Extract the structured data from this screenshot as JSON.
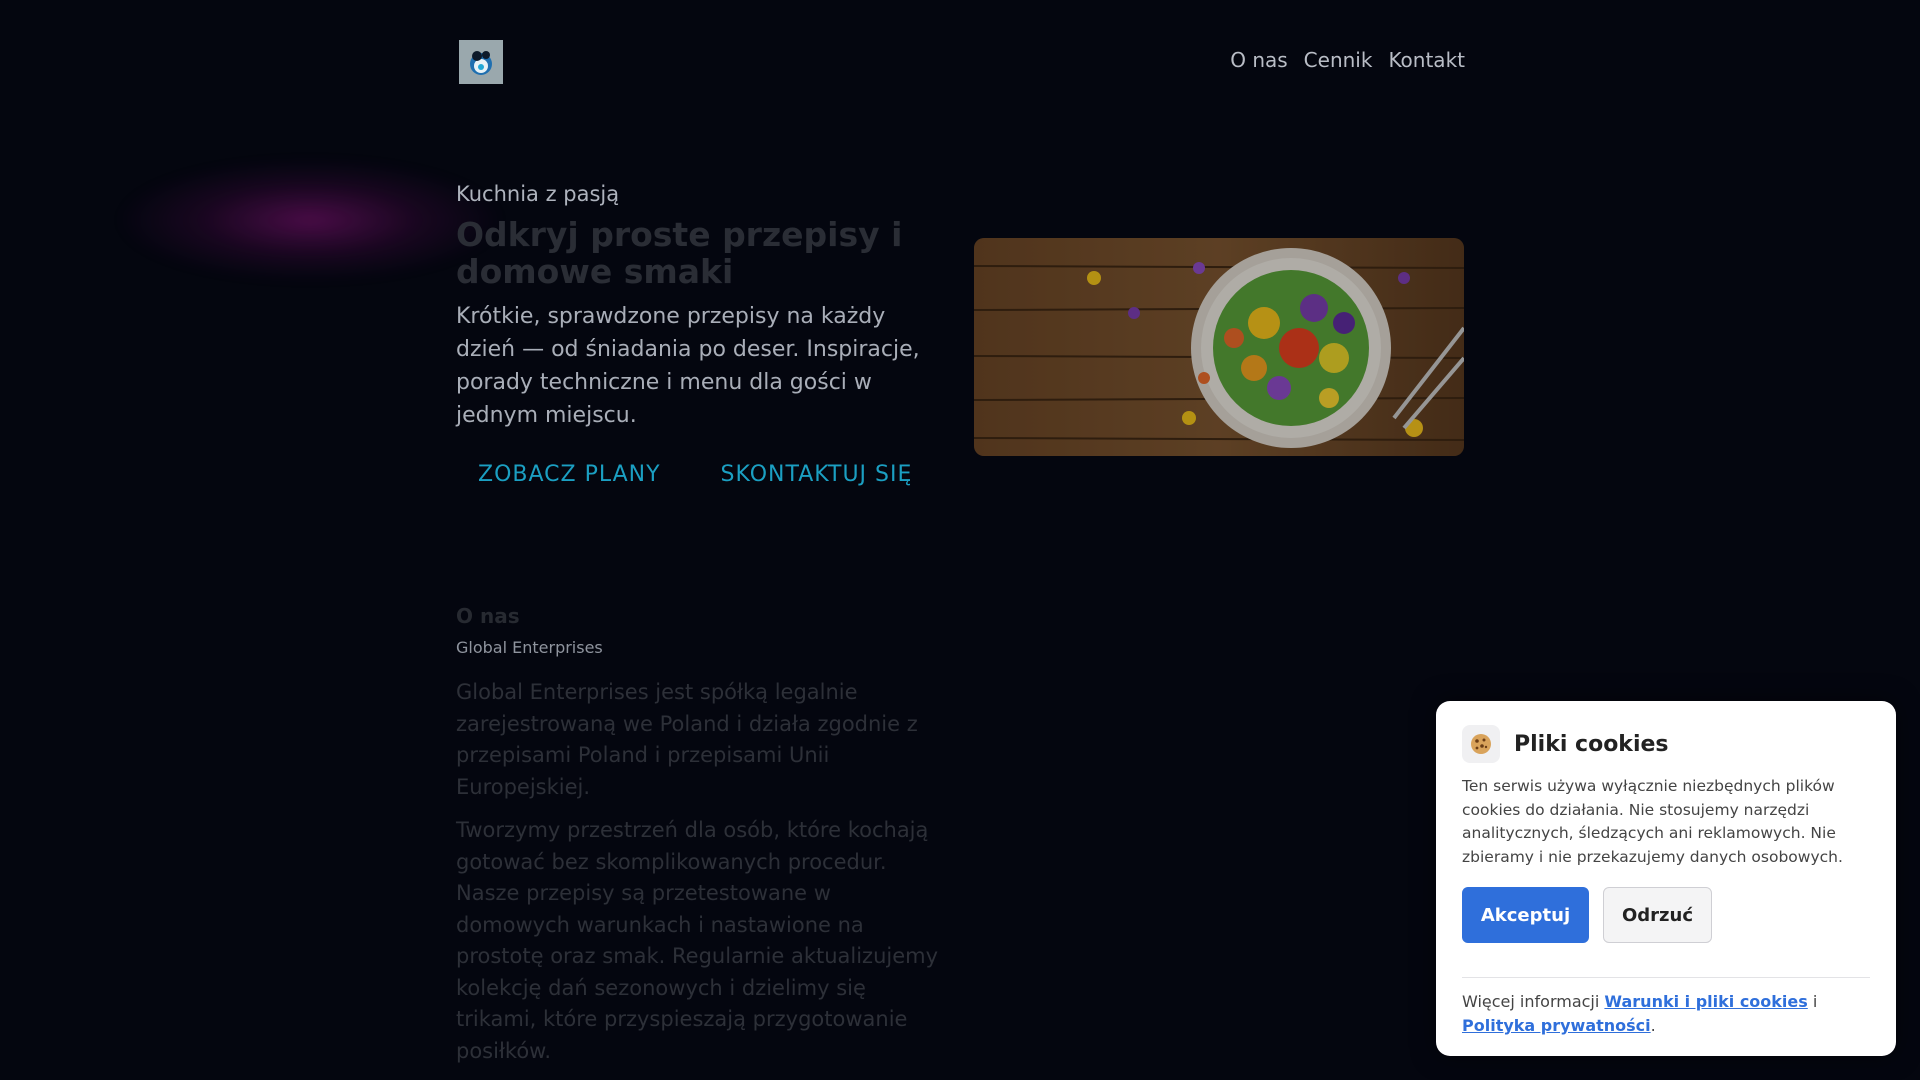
{
  "header": {
    "logo": "logo-icon",
    "nav": [
      {
        "label": "O nas"
      },
      {
        "label": "Cennik"
      },
      {
        "label": "Kontakt"
      }
    ]
  },
  "hero": {
    "eyebrow": "Kuchnia z pasją",
    "title": "Odkryj proste przepisy i domowe smaki",
    "text": "Krótkie, sprawdzone przepisy na każdy dzień — od śniadania po deser. Inspiracje, porady techniczne i menu dla gości w jednym miejscu.",
    "buttons": [
      {
        "label": "ZOBACZ PLANY"
      },
      {
        "label": "SKONTAKTUJ SIĘ"
      }
    ],
    "image": "flower-salad-plate-image"
  },
  "about": {
    "title": "O nas",
    "subtitle": "Global Enterprises",
    "paragraphs": [
      "Global Enterprises jest spółką legalnie zarejestrowaną we Poland i działa zgodnie z przepisami Poland i przepisami Unii Europejskiej.",
      "Tworzymy przestrzeń dla osób, które kochają gotować bez skomplikowanych procedur. Nasze przepisy są przetestowane w domowych warunkach i nastawione na prostotę oraz smak. Regularnie aktualizujemy kolekcję dań sezonowych i dzielimy się trikami, które przyspieszają przygotowanie posiłków."
    ]
  },
  "cookie_banner": {
    "icon": "cookie-icon",
    "title": "Pliki cookies",
    "text": "Ten serwis używa wyłącznie niezbędnych plików cookies do działania. Nie stosujemy narzędzi analitycznych, śledzących ani reklamowych. Nie zbieramy i nie przekazujemy danych osobowych.",
    "accept_label": "Akceptuj",
    "reject_label": "Odrzuć",
    "footer_prefix": "Więcej informacji",
    "terms_link": "Warunki i pliki cookies",
    "conjunction": "i",
    "privacy_link": "Polityka prywatności",
    "footer_suffix": "."
  },
  "colors": {
    "background": "#04060f",
    "accent_cyan": "#1b9fc2",
    "accept_blue": "#2f6fdb"
  }
}
